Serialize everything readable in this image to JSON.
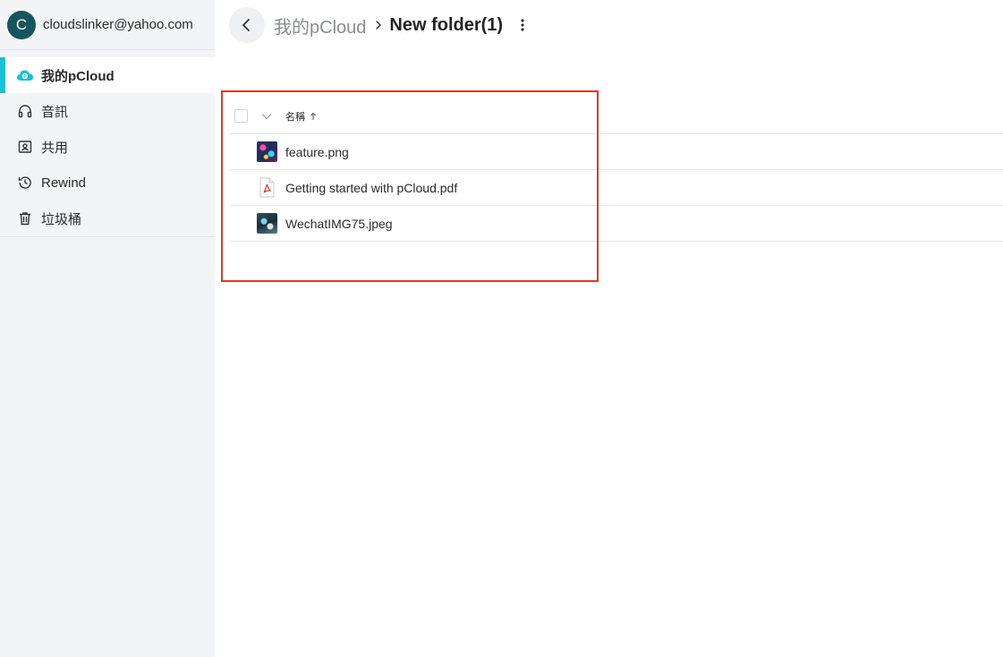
{
  "account": {
    "initial": "C",
    "email": "cloudslinker@yahoo.com"
  },
  "sidebar": {
    "items": [
      {
        "label": "我的pCloud",
        "icon": "pcloud-cloud-icon",
        "active": true
      },
      {
        "label": "音訊",
        "icon": "headphones-icon",
        "active": false
      },
      {
        "label": "共用",
        "icon": "shared-contact-icon",
        "active": false
      },
      {
        "label": "Rewind",
        "icon": "rewind-history-icon",
        "active": false
      },
      {
        "label": "垃圾桶",
        "icon": "trash-icon",
        "active": false
      }
    ]
  },
  "breadcrumb": {
    "root": "我的pCloud",
    "current": "New folder(1)"
  },
  "list": {
    "column_name": "名稱",
    "files": [
      {
        "name": "feature.png",
        "icon": "image-thumbnail"
      },
      {
        "name": "Getting started with pCloud.pdf",
        "icon": "pdf-file-icon"
      },
      {
        "name": "WechatIMG75.jpeg",
        "icon": "image-thumbnail"
      }
    ]
  },
  "colors": {
    "accent": "#17c3d0",
    "avatar": "#17555e",
    "highlight": "#e0391f",
    "sidebar_bg": "#f3f4f6"
  }
}
